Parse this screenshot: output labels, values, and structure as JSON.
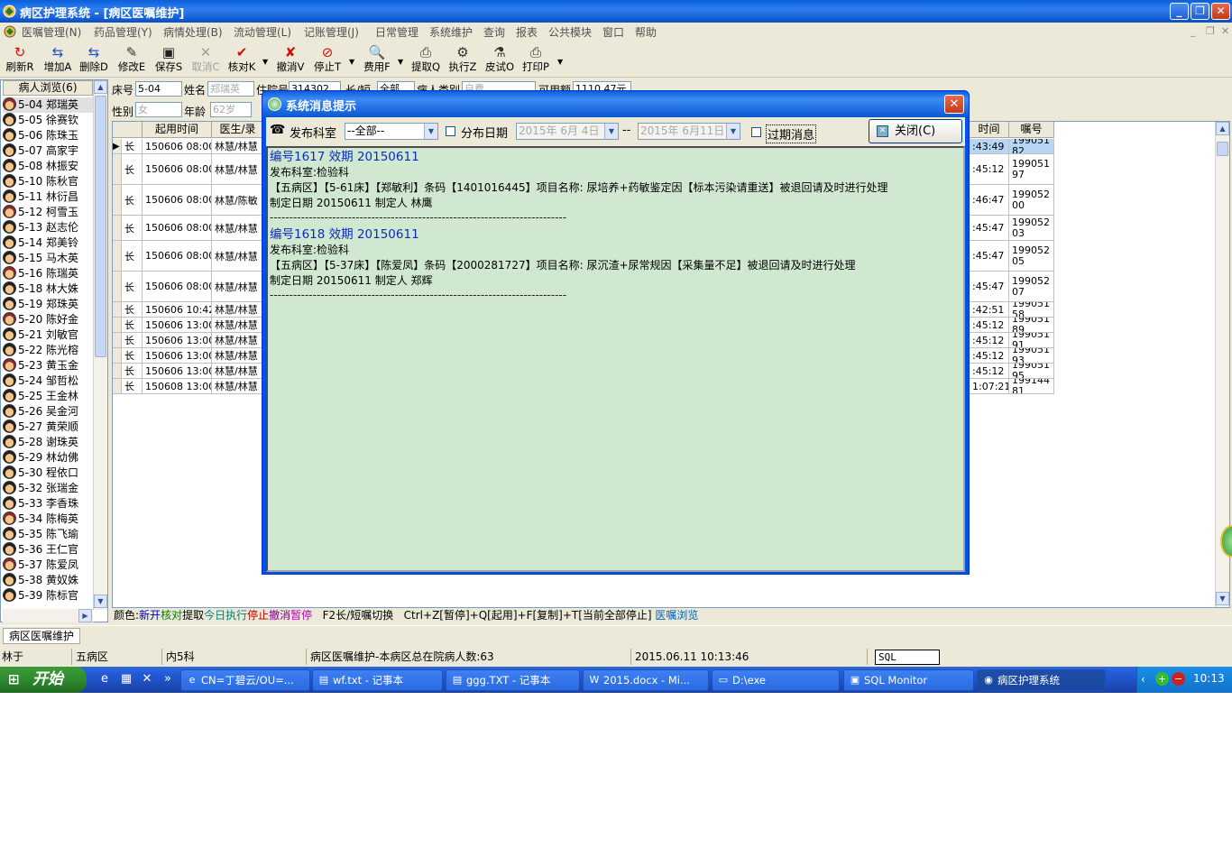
{
  "window": {
    "title": "病区护理系统 - [病区医嘱维护]",
    "min_label": "_",
    "max_label": "❐",
    "close_label": "✕"
  },
  "menu": [
    "医嘱管理(N)",
    "药品管理(Y)",
    "病情处理(B)",
    "流动管理(L)",
    "记账管理(J)",
    "日常管理",
    "系统维护",
    "查询",
    "报表",
    "公共模块",
    "窗口",
    "帮助"
  ],
  "toolbar": [
    {
      "label": "刷新R",
      "icon": "refresh-icon",
      "glyph": "↻",
      "color": "#d01010",
      "disabled": false
    },
    {
      "label": "增加A",
      "icon": "add-icon",
      "glyph": "⇆",
      "color": "#2050c0",
      "disabled": false
    },
    {
      "label": "删除D",
      "icon": "delete-icon",
      "glyph": "⇆",
      "color": "#2050c0",
      "disabled": false
    },
    {
      "label": "修改E",
      "icon": "edit-icon",
      "glyph": "✎",
      "color": "#303030",
      "disabled": false
    },
    {
      "label": "保存S",
      "icon": "save-icon",
      "glyph": "▣",
      "color": "#202020",
      "disabled": false
    },
    {
      "label": "取消C",
      "icon": "cancel-icon",
      "glyph": "✕",
      "color": "#a0a0a0",
      "disabled": true
    },
    {
      "label": "核对K",
      "icon": "check-icon",
      "glyph": "✔",
      "color": "#d01010",
      "disabled": false
    },
    {
      "label": "撤消V",
      "icon": "undo-icon",
      "glyph": "✘",
      "color": "#d01010",
      "disabled": false
    },
    {
      "label": "停止T",
      "icon": "stop-icon",
      "glyph": "⊘",
      "color": "#d01010",
      "disabled": false
    },
    {
      "label": "费用F",
      "icon": "fee-icon",
      "glyph": "🔍",
      "color": "#303030",
      "disabled": false
    },
    {
      "label": "提取Q",
      "icon": "extract-icon",
      "glyph": "⎙",
      "color": "#303030",
      "disabled": false
    },
    {
      "label": "执行Z",
      "icon": "execute-icon",
      "glyph": "⚙",
      "color": "#303030",
      "disabled": false
    },
    {
      "label": "皮试O",
      "icon": "skin-test-icon",
      "glyph": "⚗",
      "color": "#303030",
      "disabled": false
    },
    {
      "label": "打印P",
      "icon": "print-icon",
      "glyph": "⎙",
      "color": "#303030",
      "disabled": false
    }
  ],
  "patients": {
    "header": "病人浏览(6)",
    "items": [
      {
        "text": "5-04  郑瑞英",
        "gender": "f",
        "selected": true
      },
      {
        "text": "5-05  徐赛钦",
        "gender": "m"
      },
      {
        "text": "5-06  陈珠玉",
        "gender": "m"
      },
      {
        "text": "5-07  高家宇",
        "gender": "m"
      },
      {
        "text": "5-08  林振安",
        "gender": "m"
      },
      {
        "text": "5-10  陈秋官",
        "gender": "m"
      },
      {
        "text": "5-11  林衍昌",
        "gender": "m"
      },
      {
        "text": "5-12  柯雪玉",
        "gender": "f"
      },
      {
        "text": "5-13  赵志伦",
        "gender": "m"
      },
      {
        "text": "5-14  郑美铃",
        "gender": "m"
      },
      {
        "text": "5-15  马木英",
        "gender": "m"
      },
      {
        "text": "5-16  陈瑞英",
        "gender": "f"
      },
      {
        "text": "5-18  林大姝",
        "gender": "m"
      },
      {
        "text": "5-19  郑珠英",
        "gender": "m"
      },
      {
        "text": "5-20  陈好金",
        "gender": "f"
      },
      {
        "text": "5-21  刘敏官",
        "gender": "m"
      },
      {
        "text": "5-22  陈光榕",
        "gender": "m"
      },
      {
        "text": "5-23  黄玉金",
        "gender": "f"
      },
      {
        "text": "5-24  邹哲松",
        "gender": "m"
      },
      {
        "text": "5-25  王金林",
        "gender": "m"
      },
      {
        "text": "5-26  吴金河",
        "gender": "m"
      },
      {
        "text": "5-27  黄荣顺",
        "gender": "m"
      },
      {
        "text": "5-28  谢珠英",
        "gender": "m"
      },
      {
        "text": "5-29  林幼佛",
        "gender": "m"
      },
      {
        "text": "5-30  程依口",
        "gender": "m"
      },
      {
        "text": "5-32  张瑞金",
        "gender": "m"
      },
      {
        "text": "5-33  李香珠",
        "gender": "m"
      },
      {
        "text": "5-34  陈梅英",
        "gender": "f"
      },
      {
        "text": "5-35  陈飞瑜",
        "gender": "m"
      },
      {
        "text": "5-36  王仁官",
        "gender": "m"
      },
      {
        "text": "5-37  陈爱凤",
        "gender": "f"
      },
      {
        "text": "5-38  黄奴姝",
        "gender": "m"
      },
      {
        "text": "5-39  陈标官",
        "gender": "m"
      }
    ]
  },
  "header_fields": {
    "bed_label": "床号",
    "bed_value": "5-04",
    "name_label": "姓名",
    "name_value": "郑瑞英",
    "admit_label": "住院号",
    "admit_value": "314302",
    "type_label": "长/短",
    "type_value": "全部",
    "category_label": "病人类别",
    "category_value": "自费",
    "balance_label": "可用额",
    "balance_value": "1110.47元",
    "gender_label": "性别",
    "gender_value": "女",
    "age_label": "年龄",
    "age_value": "62岁"
  },
  "grid": {
    "headers": {
      "start": "起用时间",
      "doctor": "医生/录",
      "time": "时间",
      "no": "嘱号"
    },
    "rows": [
      {
        "type": "长",
        "start": "150606 08:00",
        "doctor": "林慧/林慧",
        "time": ":43:49",
        "no": "19905182",
        "selected": true
      },
      {
        "type": "长",
        "start": "150606 08:00",
        "doctor": "林慧/林慧",
        "time": ":45:12",
        "no": "19905197"
      },
      {
        "type": "长",
        "start": "150606 08:00",
        "doctor": "林慧/陈敏",
        "time": ":46:47",
        "no": "19905200"
      },
      {
        "type": "长",
        "start": "150606 08:00",
        "doctor": "林慧/林慧",
        "time": ":45:47",
        "no": "19905203"
      },
      {
        "type": "长",
        "start": "150606 08:00",
        "doctor": "林慧/林慧",
        "time": ":45:47",
        "no": "19905205"
      },
      {
        "type": "长",
        "start": "150606 08:00",
        "doctor": "林慧/林慧",
        "time": ":45:47",
        "no": "19905207"
      },
      {
        "type": "长",
        "start": "150606 10:42",
        "doctor": "林慧/林慧",
        "time": ":42:51",
        "no": "19905158"
      },
      {
        "type": "长",
        "start": "150606 13:00",
        "doctor": "林慧/林慧",
        "time": ":45:12",
        "no": "19905189"
      },
      {
        "type": "长",
        "start": "150606 13:00",
        "doctor": "林慧/林慧",
        "time": ":45:12",
        "no": "19905191"
      },
      {
        "type": "长",
        "start": "150606 13:00",
        "doctor": "林慧/林慧",
        "time": ":45:12",
        "no": "19905193"
      },
      {
        "type": "长",
        "start": "150606 13:00",
        "doctor": "林慧/林慧",
        "time": ":45:12",
        "no": "19905195"
      },
      {
        "type": "长",
        "start": "150608 13:00",
        "doctor": "林慧/林慧",
        "time": "1:07:21",
        "no": "19914481"
      }
    ]
  },
  "legend": {
    "prefix": "颜色:",
    "items": [
      {
        "text": "新开",
        "color": "#0000c0"
      },
      {
        "text": "核对",
        "color": "#008000"
      },
      {
        "text": "提取",
        "color": "#000000"
      },
      {
        "text": "今日执行",
        "color": "#008080"
      },
      {
        "text": "停止",
        "color": "#c00000"
      },
      {
        "text": "撤消",
        "color": "#800080"
      },
      {
        "text": "暂停",
        "color": "#c000c0"
      }
    ],
    "shortcut1": "F2长/短嘱切换",
    "shortcut2": "Ctrl+Z[暂停]+Q[起用]+F[复制]+T[当前全部停止]",
    "browse_link": "医嘱浏览"
  },
  "tab_label": "病区医嘱维护",
  "statusbar": {
    "user": "林于",
    "ward": "五病区",
    "dept": "内5科",
    "info": "病区医嘱维护-本病区总在院病人数:63",
    "datetime": "2015.06.11 10:13:46",
    "sql_monitor": "SQL Monitor"
  },
  "dialog": {
    "title": "系统消息提示",
    "dept_label": "发布科室",
    "dept_value": "--全部--",
    "date_label": "分布日期",
    "date_from": "2015年 6月 4日",
    "date_sep": "--",
    "date_to": "2015年 6月11日",
    "expired_label": "过期消息",
    "close_label": "关闭(C)",
    "separator": "----------------------------------------------------------------------------",
    "messages": [
      {
        "head": "编号1617 效期 20150611",
        "dept": "发布科室:检验科",
        "content": "【五病区】【5-61床】【郑敏利】条码【1401016445】项目名称: 尿培养+药敏鉴定因【标本污染请重送】被退回请及时进行处理",
        "footer": "制定日期 20150611 制定人 林鹰"
      },
      {
        "head": "编号1618 效期 20150611",
        "dept": "发布科室:检验科",
        "content": "【五病区】【5-37床】【陈爱凤】条码【2000281727】项目名称: 尿沉渣+尿常规因【采集量不足】被退回请及时进行处理",
        "footer": "制定日期 20150611 制定人 郑辉"
      }
    ]
  },
  "taskbar": {
    "start_label": "开始",
    "tasks": [
      {
        "label": "CN=丁碧云/OU=...",
        "icon": "browser-icon",
        "glyph": "e",
        "active": false
      },
      {
        "label": "wf.txt - 记事本",
        "icon": "notepad-icon",
        "glyph": "▤",
        "active": false
      },
      {
        "label": "ggg.TXT - 记事本",
        "icon": "notepad-icon",
        "glyph": "▤",
        "active": false
      },
      {
        "label": "2015.docx - Mi...",
        "icon": "word-icon",
        "glyph": "W",
        "active": false
      },
      {
        "label": "D:\\exe",
        "icon": "folder-icon",
        "glyph": "▭",
        "active": false
      },
      {
        "label": "SQL Monitor",
        "icon": "sql-monitor-icon",
        "glyph": "▣",
        "active": false
      },
      {
        "label": "病区护理系统",
        "icon": "nursing-app-icon",
        "glyph": "◉",
        "active": true
      }
    ],
    "clock": "10:13"
  }
}
